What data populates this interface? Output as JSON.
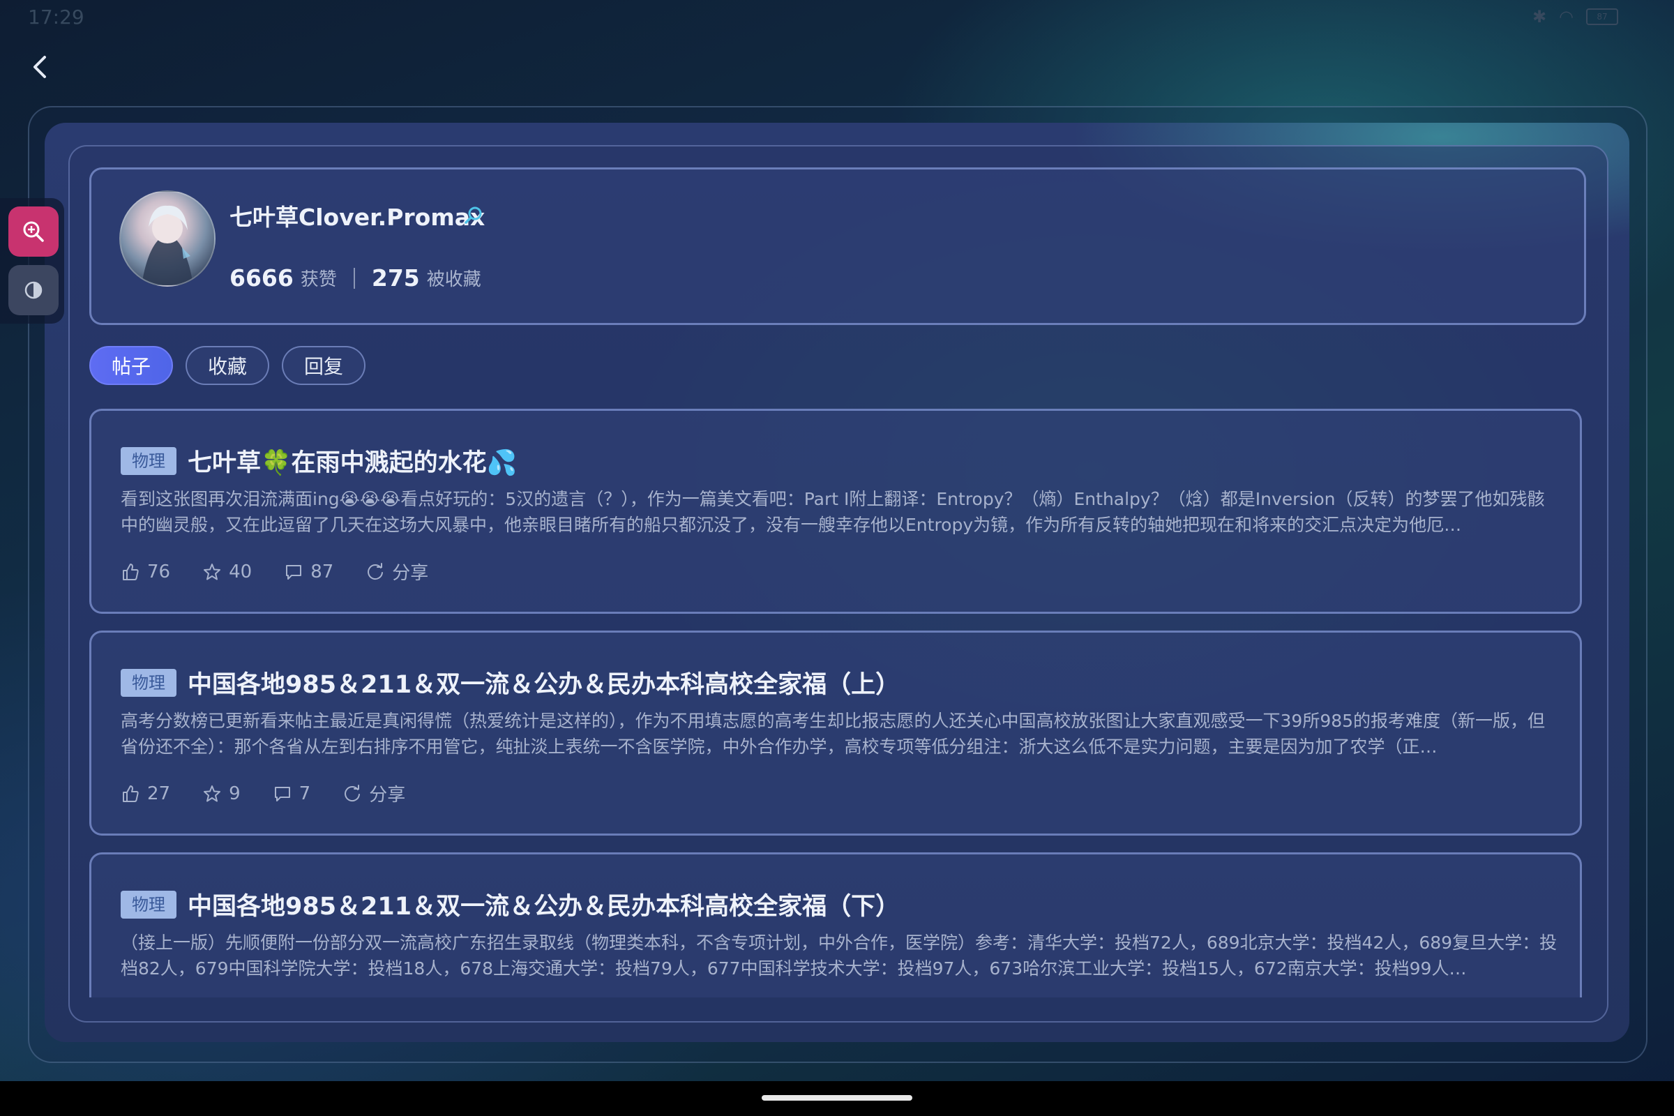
{
  "status_bar": {
    "time": "17:29",
    "battery": "87"
  },
  "profile": {
    "username": "七叶草Clover.Promax",
    "likes_count": "6666",
    "likes_label": "获赞",
    "favorites_count": "275",
    "favorites_label": "被收藏"
  },
  "tabs": [
    {
      "label": "帖子",
      "active": true
    },
    {
      "label": "收藏",
      "active": false
    },
    {
      "label": "回复",
      "active": false
    }
  ],
  "posts": [
    {
      "tag": "物理",
      "title": "七叶草🍀在雨中溅起的水花💦",
      "body": "看到这张图再次泪流满面ing😭😭😭看点好玩的：5汉的遗言（？），作为一篇美文看吧：Part I附上翻译：Entropy？（熵）Enthalpy？（焓）都是Inversion（反转）的梦罢了他如残骸中的幽灵般，又在此逗留了几天在这场大风暴中，他亲眼目睹所有的船只都沉没了，没有一艘幸存他以Entropy为镜，作为所有反转的轴她把现在和将来的交汇点决定为他厄…",
      "likes": "76",
      "stars": "40",
      "comments": "87",
      "share": "分享"
    },
    {
      "tag": "物理",
      "title": "中国各地985＆211＆双一流＆公办＆民办本科高校全家福（上）",
      "body": "高考分数榜已更新看来帖主最近是真闲得慌（热爱统计是这样的），作为不用填志愿的高考生却比报志愿的人还关心中国高校放张图让大家直观感受一下39所985的报考难度（新一版，但省份还不全）：那个各省从左到右排序不用管它，纯扯淡上表统一不含医学院，中外合作办学，高校专项等低分组注：浙大这么低不是实力问题，主要是因为加了农学（正…",
      "likes": "27",
      "stars": "9",
      "comments": "7",
      "share": "分享"
    },
    {
      "tag": "物理",
      "title": "中国各地985＆211＆双一流＆公办＆民办本科高校全家福（下）",
      "body": "（接上一版）先顺便附一份部分双一流高校广东招生录取线（物理类本科，不含专项计划，中外合作，医学院）参考：清华大学：投档72人，689北京大学：投档42人，689复旦大学：投档82人，679中国科学院大学：投档18人，678上海交通大学：投档79人，677中国科学技术大学：投档97人，673哈尔滨工业大学：投档15人，672南京大学：投档99人…"
    }
  ]
}
